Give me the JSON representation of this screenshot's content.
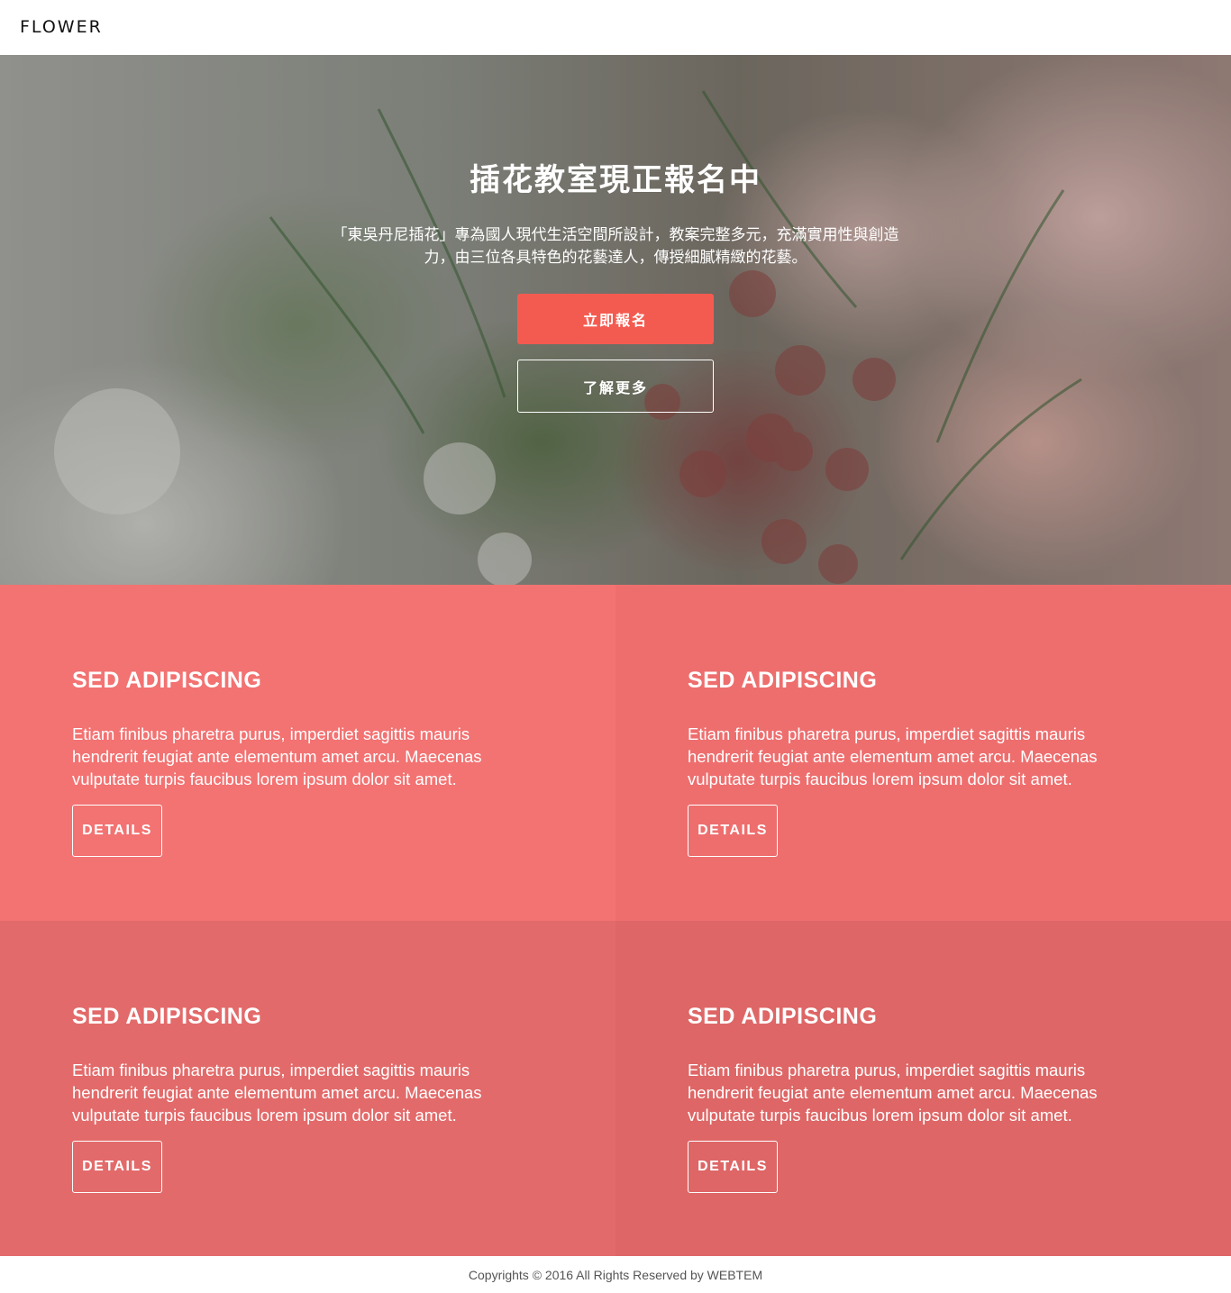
{
  "header": {
    "brand": "FLOWER"
  },
  "hero": {
    "title": "插花教室現正報名中",
    "description": "「東吳丹尼插花」專為國人現代生活空間所設計，教案完整多元，充滿實用性與創造力，由三位各具特色的花藝達人，傳授細膩精緻的花藝。",
    "primary_button": "立即報名",
    "secondary_button": "了解更多"
  },
  "features": [
    {
      "title": "SED ADIPISCING",
      "text": "Etiam finibus pharetra purus, imperdiet sagittis mauris hendrerit feugiat ante elementum amet arcu. Maecenas vulputate turpis faucibus lorem ipsum dolor sit amet.",
      "button": "DETAILS",
      "color": "#f37272"
    },
    {
      "title": "SED ADIPISCING",
      "text": "Etiam finibus pharetra purus, imperdiet sagittis mauris hendrerit feugiat ante elementum amet arcu. Maecenas vulputate turpis faucibus lorem ipsum dolor sit amet.",
      "button": "DETAILS",
      "color": "#ee6e6e"
    },
    {
      "title": "SED ADIPISCING",
      "text": "Etiam finibus pharetra purus, imperdiet sagittis mauris hendrerit feugiat ante elementum amet arcu. Maecenas vulputate turpis faucibus lorem ipsum dolor sit amet.",
      "button": "DETAILS",
      "color": "#e36a6a"
    },
    {
      "title": "SED ADIPISCING",
      "text": "Etiam finibus pharetra purus, imperdiet sagittis mauris hendrerit feugiat ante elementum amet arcu. Maecenas vulputate turpis faucibus lorem ipsum dolor sit amet.",
      "button": "DETAILS",
      "color": "#de6666"
    }
  ],
  "footer": {
    "copyright": "Copyrights © 2016 All Rights Reserved by WEBTEM"
  },
  "colors": {
    "accent": "#f45b50"
  }
}
